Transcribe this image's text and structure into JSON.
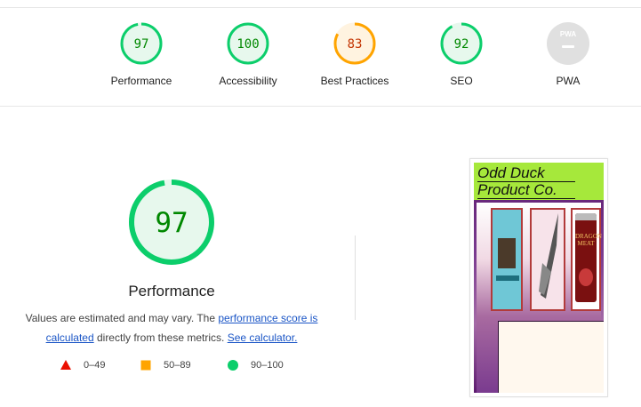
{
  "categories": [
    {
      "id": "performance",
      "score": "97",
      "label": "Performance",
      "level": "pass"
    },
    {
      "id": "accessibility",
      "score": "100",
      "label": "Accessibility",
      "level": "pass"
    },
    {
      "id": "best-practices",
      "score": "83",
      "label": "Best Practices",
      "level": "average"
    },
    {
      "id": "seo",
      "score": "92",
      "label": "SEO",
      "level": "pass"
    },
    {
      "id": "pwa",
      "score": "PWA",
      "label": "PWA",
      "level": "na"
    }
  ],
  "main": {
    "score": "97",
    "title": "Performance",
    "desc_prefix": "Values are estimated and may vary. The ",
    "desc_link1": "performance score is calculated",
    "desc_middle": " directly from these metrics. ",
    "desc_link2": "See calculator."
  },
  "legend": [
    {
      "range": "0–49",
      "shape": "triangle",
      "color": "#eb0f00"
    },
    {
      "range": "50–89",
      "shape": "square",
      "color": "#ffa400"
    },
    {
      "range": "90–100",
      "shape": "circle",
      "color": "#0cce6b"
    }
  ],
  "screenshot": {
    "header_line1": "Odd Duck",
    "header_line2": "Product Co.",
    "product3_text": "DRAGON MEAT"
  },
  "colors": {
    "pass": "#0cce6b",
    "pass_text": "#008800",
    "pass_bg": "#e7f8ed",
    "average": "#ffa400",
    "average_text": "#c33300",
    "average_bg": "#fff3e0",
    "na": "#e0e0e0"
  }
}
